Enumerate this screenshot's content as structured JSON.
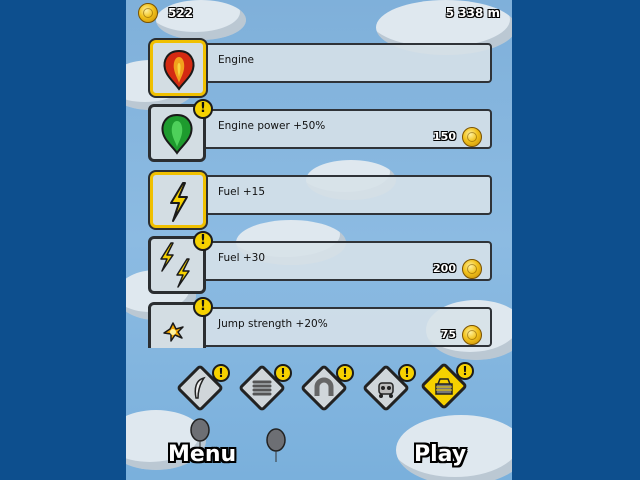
{
  "hud": {
    "coins": "522",
    "distance": "5 338 m"
  },
  "upgrades": [
    {
      "label": "Engine",
      "price": "",
      "alert": false,
      "selected": true,
      "icon": "red-balloon-icon"
    },
    {
      "label": "Engine power +50%",
      "price": "150",
      "alert": true,
      "selected": false,
      "icon": "green-balloon-icon"
    },
    {
      "label": "Fuel +15",
      "price": "",
      "alert": false,
      "selected": true,
      "icon": "lightning-icon"
    },
    {
      "label": "Fuel +30",
      "price": "200",
      "alert": true,
      "selected": false,
      "icon": "double-lightning-icon"
    },
    {
      "label": "Jump strength +20%",
      "price": "75",
      "alert": true,
      "selected": false,
      "icon": "spark-icon"
    }
  ],
  "categories": [
    {
      "icon": "feather-icon",
      "alert": true,
      "active": false
    },
    {
      "icon": "spring-icon",
      "alert": true,
      "active": false
    },
    {
      "icon": "magnet-icon",
      "alert": true,
      "active": false
    },
    {
      "icon": "robot-icon",
      "alert": true,
      "active": false
    },
    {
      "icon": "basket-icon",
      "alert": true,
      "active": true
    }
  ],
  "buttons": {
    "menu": "Menu",
    "play": "Play"
  },
  "alert_mark": "!",
  "colors": {
    "background": "#0d4f8e",
    "accent": "#f6d200",
    "sky": "#8cbbe2"
  }
}
